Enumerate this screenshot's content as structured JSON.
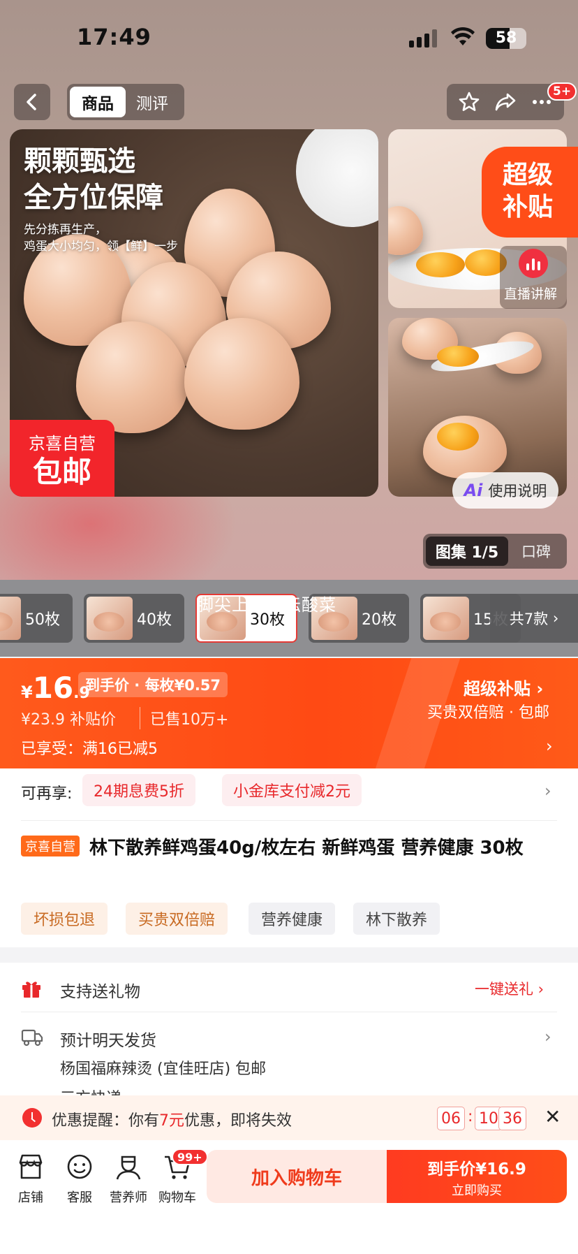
{
  "status_bar": {
    "time": "17:49",
    "battery": "58",
    "battery_level": 0.58
  },
  "header": {
    "tabs": [
      {
        "label": "商品",
        "active": true
      },
      {
        "label": "测评",
        "active": false
      }
    ],
    "more_badge": "5+",
    "icons": [
      "back-icon",
      "star-icon",
      "share-icon",
      "more-icon"
    ]
  },
  "gallery": {
    "main_headline_1": "颗颗甄选",
    "main_headline_2": "全方位保障",
    "main_sub_1": "先分拣再生产，",
    "main_sub_2": "鸡蛋大小均匀，领【鲜】一步",
    "self_badge_1": "京喜自营",
    "self_badge_2": "包邮",
    "super_subsidy_1": "超级",
    "super_subsidy_2": "补贴",
    "live_label": "直播讲解",
    "usage_ai": "Ai",
    "usage_label": "使用说明",
    "switch_album": "图集 1/5",
    "switch_reviews": "口碑"
  },
  "variants": {
    "items": [
      {
        "label": "50枚",
        "active": false
      },
      {
        "label": "40枚",
        "active": false
      },
      {
        "label": "30枚",
        "active": true
      },
      {
        "label": "20枚",
        "active": false
      },
      {
        "label": "15枚",
        "active": false
      }
    ],
    "total": "共7款",
    "ticker": "脚尖上的老坛酸菜"
  },
  "price": {
    "yen": "¥",
    "integer": "16",
    "decimal": ".9",
    "tag": "到手价 · 每枚¥0.57",
    "original": "¥23.9  补贴价",
    "sold": "已售10万+",
    "super_link": "超级补贴 ›",
    "super_desc": "买贵双倍赔 · 包邮",
    "promo_line": "已享受：满16已减5",
    "colors": {
      "accent": "#ff4a14",
      "red": "#e8282b"
    }
  },
  "info": {
    "also_label": "可再享:",
    "promos": [
      "24期息费5折",
      "小金库支付减2元"
    ],
    "self_tag": "京喜自营",
    "title": "林下散养鲜鸡蛋40g/枚左右 新鲜鸡蛋 营养健康 30枚",
    "features": [
      {
        "label": "坏损包退",
        "style": "orange"
      },
      {
        "label": "买贵双倍赔",
        "style": "orange"
      },
      {
        "label": "营养健康",
        "style": "grey"
      },
      {
        "label": "林下散养",
        "style": "grey"
      }
    ]
  },
  "service": {
    "gift_label": "支持送礼物",
    "gift_action": "一键送礼 ›",
    "ship_label": "预计明天发货",
    "store_line": "杨国福麻辣烫 (宜佳旺店)    包邮",
    "carrier_line": "三方快递"
  },
  "reminder": {
    "prefix": "优惠提醒：你有",
    "amount": "7元",
    "suffix": "优惠，即将失效",
    "countdown": [
      "06",
      "10",
      "36"
    ],
    "separator": ":"
  },
  "bottom_bar": {
    "nav": [
      {
        "label": "店铺",
        "icon": "store-icon"
      },
      {
        "label": "客服",
        "icon": "service-icon"
      },
      {
        "label": "营养师",
        "icon": "nutritionist-icon"
      },
      {
        "label": "购物车",
        "icon": "cart-icon"
      }
    ],
    "cart_badge": "99+",
    "add_cart": "加入购物车",
    "buy_price": "到手价¥16.9",
    "buy_label": "立即购买"
  }
}
